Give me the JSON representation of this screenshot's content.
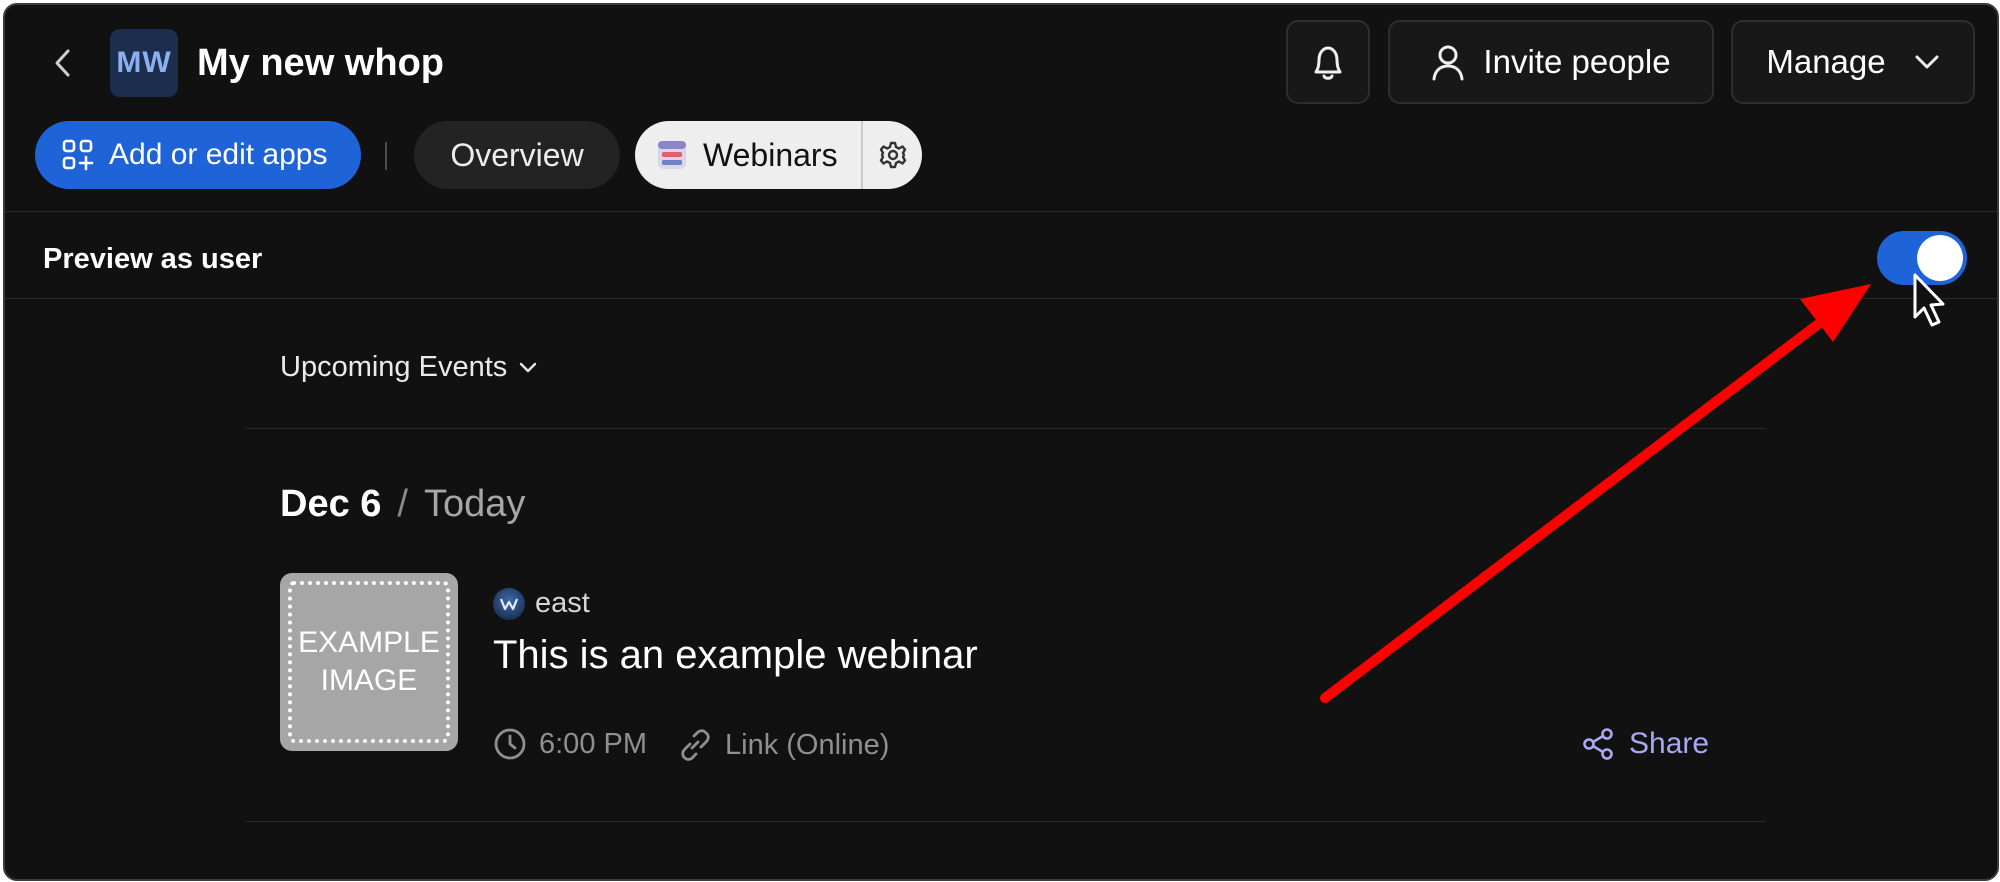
{
  "header": {
    "avatar_initials": "MW",
    "title": "My new whop",
    "invite_label": "Invite people",
    "manage_label": "Manage"
  },
  "tabs": {
    "add_apps_label": "Add or edit apps",
    "overview_label": "Overview",
    "webinars_label": "Webinars"
  },
  "preview": {
    "label": "Preview as user",
    "toggle_on": true
  },
  "events": {
    "filter_label": "Upcoming Events",
    "date_main": "Dec 6",
    "date_separator": "/",
    "date_sub": "Today",
    "items": [
      {
        "thumbnail_text": "EXAMPLE IMAGE",
        "host": "east",
        "title": "This is an example webinar",
        "time": "6:00 PM",
        "location": "Link (Online)",
        "share_label": "Share"
      }
    ]
  },
  "colors": {
    "background": "#111111",
    "accent_blue": "#1f63d9",
    "share_purple": "#a9a6f2",
    "annotation_red": "#ff0000"
  },
  "icons": [
    "chevron-left-icon",
    "bell-icon",
    "user-icon",
    "chevron-down-icon",
    "apps-grid-icon",
    "webinar-app-icon",
    "gear-icon",
    "clock-icon",
    "link-icon",
    "share-icon"
  ]
}
